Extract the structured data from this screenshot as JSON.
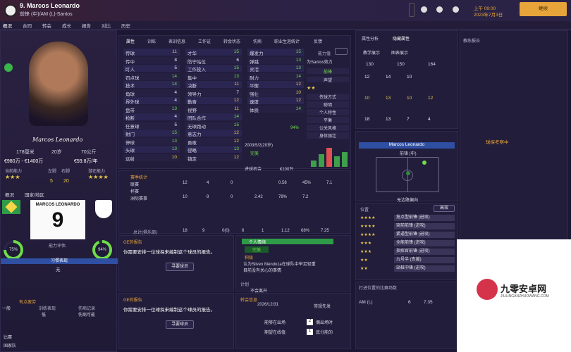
{
  "header": {
    "number_name": "9. Marcos Leonardo",
    "subtitle": "前锋 (中)/AM (L)-Santos",
    "time": "上午 09:00",
    "date": "2023年7月3日",
    "continue_label": "继续"
  },
  "nav": [
    "概况",
    "合同",
    "转会",
    "成长",
    "报告",
    "对比",
    "历史"
  ],
  "profile": {
    "signature": "Marcos Leonardo",
    "height": "178厘米",
    "age": "20岁",
    "weight": "70公斤",
    "value": "€980万 - €1400万",
    "wage": "€59.8万/年",
    "ability_label": "当前能力",
    "potential_label": "潜在能力",
    "left_foot_label": "左脚",
    "right_foot_label": "右脚",
    "left_foot_val": "5",
    "right_foot_val": "20",
    "overview_label": "概况",
    "nation_label": "国家/地区",
    "shirt_name": "MARCOS LEONARDO",
    "shirt_number": "9",
    "scout_label": "能力评估",
    "scout_pct_left": "75%",
    "scout_pct_right": "94%",
    "habit_label": "习惯表现",
    "habit_val": "无",
    "strength_label": "有点疲劳",
    "condition_label": "训练表现",
    "form_label": "伤病记录",
    "col1": "一般",
    "col2": "低",
    "col3": "伤病可能",
    "bottom1": "比赛",
    "bottom2": "国家队"
  },
  "attr_tabs": [
    "属性",
    "训练",
    "表训信息",
    "工作证",
    "转会状态",
    "伤病",
    "职业生涯统计",
    "反馈"
  ],
  "attributes": {
    "technical": [
      {
        "name": "传球",
        "v": "11"
      },
      {
        "name": "传中",
        "v": "8"
      },
      {
        "name": "盯人",
        "v": "5"
      },
      {
        "name": "罚点球",
        "v": "14"
      },
      {
        "name": "技术",
        "v": "14"
      },
      {
        "name": "角球",
        "v": "4"
      },
      {
        "name": "界外球",
        "v": "4"
      },
      {
        "name": "盘带",
        "v": "13"
      },
      {
        "name": "抢断",
        "v": "4"
      },
      {
        "name": "任意球",
        "v": "5"
      },
      {
        "name": "射门",
        "v": "15"
      },
      {
        "name": "停球",
        "v": "13"
      },
      {
        "name": "头球",
        "v": "13"
      },
      {
        "name": "远射",
        "v": "10"
      }
    ],
    "mental": [
      {
        "name": "才华",
        "v": "15"
      },
      {
        "name": "防守站位",
        "v": "6"
      },
      {
        "name": "工作投入",
        "v": "15"
      },
      {
        "name": "集中",
        "v": "13"
      },
      {
        "name": "决断",
        "v": "11"
      },
      {
        "name": "领导力",
        "v": "7"
      },
      {
        "name": "勤奋",
        "v": "12"
      },
      {
        "name": "视野",
        "v": "11"
      },
      {
        "name": "团队合作",
        "v": "14"
      },
      {
        "name": "无球跑动",
        "v": "15"
      },
      {
        "name": "意志力",
        "v": "12"
      },
      {
        "name": "勇敢",
        "v": "12"
      },
      {
        "name": "侵略",
        "v": "13"
      },
      {
        "name": "镇定",
        "v": "12"
      }
    ],
    "physical": [
      {
        "name": "爆发力",
        "v": "15"
      },
      {
        "name": "弹跳",
        "v": "13"
      },
      {
        "name": "灵活",
        "v": "13"
      },
      {
        "name": "耐力",
        "v": "14"
      },
      {
        "name": "平衡",
        "v": "12"
      },
      {
        "name": "强壮",
        "v": "10"
      },
      {
        "name": "速度",
        "v": "12"
      },
      {
        "name": "体质",
        "v": "14"
      }
    ],
    "ability_label": "能力值",
    "club_label": "为Santos效力",
    "tags": [
      "前锋",
      "声望"
    ],
    "traits": [
      "传球方式",
      "聪明",
      "个人特性",
      "平衡",
      "公关风格",
      "身体强壮"
    ],
    "misc1": "比赛状态",
    "misc2": "伤病",
    "dob": "2003/5/2(20岁)",
    "done": "完美",
    "contract": "进球机会",
    "wage2": "€100万",
    "pct": "94%"
  },
  "stats": {
    "tab1": "赛季统计",
    "rows": [
      {
        "label": "联赛",
        "v": [
          "12",
          "4",
          "0",
          "",
          "0.58",
          "45%",
          "7.1"
        ]
      },
      {
        "label": "杯赛",
        "v": [
          "",
          "",
          "",
          "",
          "",
          "",
          ""
        ]
      },
      {
        "label": "洲际赛事",
        "v": [
          "10",
          "8",
          "0",
          "2.42",
          "78%",
          "7.2"
        ]
      }
    ],
    "total_label": "总计(俱乐部)",
    "total": [
      "18",
      "9",
      "0(0)",
      "6",
      "1",
      "1.12",
      "68%",
      "7.25"
    ]
  },
  "reports": {
    "left_title": "GE的报告",
    "left_text": "你需要安排一位球探来编制这个球员的报告。",
    "scout_btn": "寻要球员",
    "left_title2": "GE的报告",
    "left_text2": "你需要安排一位球探来编制这个球员的报告。",
    "scout_btn2": "寻要球员",
    "mid_title": "个人情绪",
    "mid_status": "完美",
    "mid_label": "积极",
    "bullet1": "认为Silven Mendoza在球队中举足轻重",
    "bullet2": "目前没有关心的事情",
    "plan_label": "计划",
    "plan_val": "不会离开",
    "transfer_title": "转会信息",
    "transfer_date": "2026/12/31",
    "transfer_status": "常规先发",
    "transfer_row1": "能够在出场",
    "transfer_row2": "期望在线值",
    "transfer_val1": "2",
    "transfer_val2": "1",
    "transfer_sub1": "偶出场时",
    "transfer_sub2": "底分能的"
  },
  "right": {
    "tabs": [
      "属性分析",
      "隐藏属性"
    ],
    "sub1": "教学展示",
    "sub2": "图表展示",
    "cols": [
      "130",
      "150",
      "164"
    ],
    "vals": [
      "12",
      "14",
      "10",
      "10",
      "13",
      "10",
      "12",
      "18",
      "13",
      "7",
      "4"
    ],
    "pitch_name": "Marcos Leonardo",
    "pitch_role": "前锋 (中)",
    "pitch_sub": "无边路偏向",
    "pos_label": "位置",
    "pos_btn": "高效",
    "positions": [
      {
        "stars": "★★★★",
        "role": "抢点型前锋",
        "duty": "进攻"
      },
      {
        "stars": "★★★★",
        "role": "突前前锋",
        "duty": "进攻"
      },
      {
        "stars": "★★★★",
        "role": "紧逼型前锋",
        "duty": "进攻"
      },
      {
        "stars": "★★★",
        "role": "全能前锋",
        "duty": "进攻"
      },
      {
        "stars": "★★★",
        "role": "指挥官前锋",
        "duty": "进攻"
      },
      {
        "stars": "★★",
        "role": "九号半",
        "duty": "支援"
      },
      {
        "stars": "★★",
        "role": "站桩中锋",
        "duty": "进攻"
      }
    ],
    "last_title": "打进位置的比赛场数",
    "last_row": [
      "AM (L)",
      "6",
      "7.35"
    ],
    "scout_title": "教练报告",
    "scout_btn": "球探考察中"
  },
  "watermark": "九零安卓网",
  "watermark_sub": "JIULINGANZHUOWANG.COM",
  "colors": {
    "accent": "#e7a43a",
    "green": "#6fdc4a",
    "bg": "#1c1833",
    "panel": "#221d3b"
  }
}
